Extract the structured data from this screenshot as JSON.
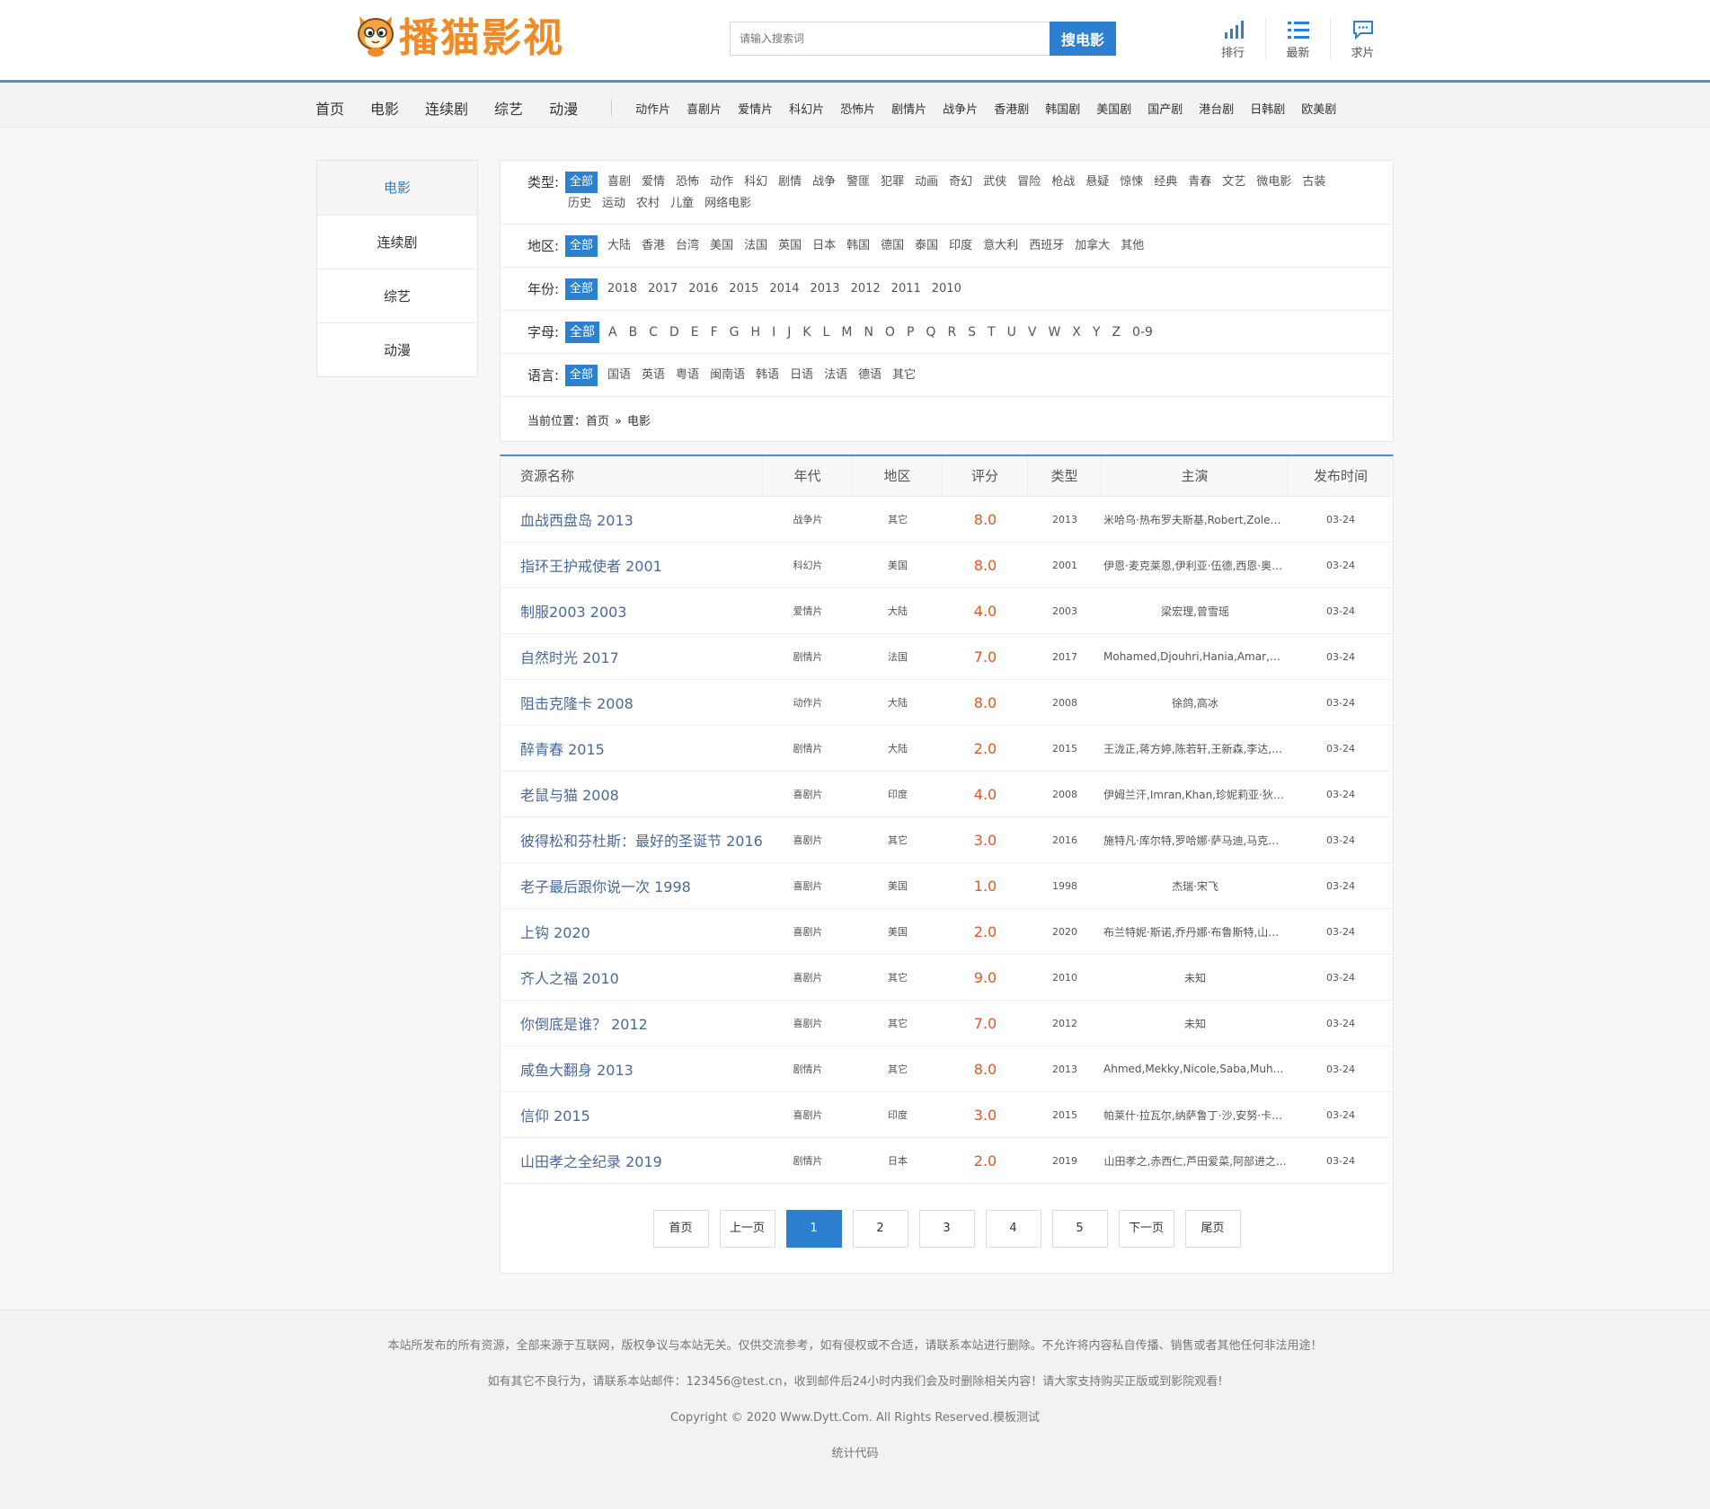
{
  "brand": {
    "logo_text": "播猫影视",
    "accent": "#2d7fd0",
    "logo_color": "#f08a24"
  },
  "search": {
    "placeholder": "请输入搜索词",
    "button": "搜电影"
  },
  "header_nav": [
    {
      "label": "排行",
      "icon": "bar-chart-icon"
    },
    {
      "label": "最新",
      "icon": "list-icon"
    },
    {
      "label": "求片",
      "icon": "chat-icon"
    }
  ],
  "main_nav": [
    "首页",
    "电影",
    "连续剧",
    "综艺",
    "动漫"
  ],
  "sub_nav": [
    "动作片",
    "喜剧片",
    "爱情片",
    "科幻片",
    "恐怖片",
    "剧情片",
    "战争片",
    "香港剧",
    "韩国剧",
    "美国剧",
    "国产剧",
    "港台剧",
    "日韩剧",
    "欧美剧"
  ],
  "side_nav": [
    "电影",
    "连续剧",
    "综艺",
    "动漫"
  ],
  "filters": {
    "type": {
      "label": "类型:",
      "options": [
        "全部",
        "喜剧",
        "爱情",
        "恐怖",
        "动作",
        "科幻",
        "剧情",
        "战争",
        "警匪",
        "犯罪",
        "动画",
        "奇幻",
        "武侠",
        "冒险",
        "枪战",
        "悬疑",
        "惊悚",
        "经典",
        "青春",
        "文艺",
        "微电影",
        "古装",
        "历史",
        "运动",
        "农村",
        "儿童",
        "网络电影"
      ]
    },
    "region": {
      "label": "地区:",
      "options": [
        "全部",
        "大陆",
        "香港",
        "台湾",
        "美国",
        "法国",
        "英国",
        "日本",
        "韩国",
        "德国",
        "泰国",
        "印度",
        "意大利",
        "西班牙",
        "加拿大",
        "其他"
      ]
    },
    "year": {
      "label": "年份:",
      "options": [
        "全部",
        "2018",
        "2017",
        "2016",
        "2015",
        "2014",
        "2013",
        "2012",
        "2011",
        "2010"
      ]
    },
    "letter": {
      "label": "字母:",
      "options": [
        "全部",
        "A",
        "B",
        "C",
        "D",
        "E",
        "F",
        "G",
        "H",
        "I",
        "J",
        "K",
        "L",
        "M",
        "N",
        "O",
        "P",
        "Q",
        "R",
        "S",
        "T",
        "U",
        "V",
        "W",
        "X",
        "Y",
        "Z",
        "0-9"
      ]
    },
    "language": {
      "label": "语言:",
      "options": [
        "全部",
        "国语",
        "英语",
        "粤语",
        "闽南语",
        "韩语",
        "日语",
        "法语",
        "德语",
        "其它"
      ]
    }
  },
  "breadcrumb": {
    "prefix": "当前位置：",
    "home": "首页",
    "sep": "»",
    "current": "电影"
  },
  "table": {
    "headers": [
      "资源名称",
      "年代",
      "地区",
      "评分",
      "类型",
      "主演",
      "发布时间"
    ],
    "rows": [
      [
        "血战西盘岛 2013",
        "战争片",
        "其它",
        "8.0",
        "2013",
        "米哈乌·热布罗夫斯基,Robert,Zoledzi...",
        "03-24"
      ],
      [
        "指环王护戒使者 2001",
        "科幻片",
        "美国",
        "8.0",
        "2001",
        "伊恩·麦克莱恩,伊利亚·伍德,西恩·奥斯...",
        "03-24"
      ],
      [
        "制服2003 2003",
        "爱情片",
        "大陆",
        "4.0",
        "2003",
        "梁宏理,曾雪瑶",
        "03-24"
      ],
      [
        "自然时光 2017",
        "剧情片",
        "法国",
        "7.0",
        "2017",
        "Mohamed,Djouhri,Hania,Amar,Has...",
        "03-24"
      ],
      [
        "阻击克隆卡 2008",
        "动作片",
        "大陆",
        "8.0",
        "2008",
        "徐鸽,高冰",
        "03-24"
      ],
      [
        "醉青春 2015",
        "剧情片",
        "大陆",
        "2.0",
        "2015",
        "王泷正,蒋方婷,陈若轩,王新森,李达,尚...",
        "03-24"
      ],
      [
        "老鼠与猫 2008",
        "喜剧片",
        "印度",
        "4.0",
        "2008",
        "伊姆兰汗,Imran,Khan,珍妮莉亚·狄索...",
        "03-24"
      ],
      [
        "彼得松和芬杜斯：最好的圣诞节 2016",
        "喜剧片",
        "其它",
        "3.0",
        "2016",
        "施特凡·库尔特,罗哈娜·萨马迪,马克斯·...",
        "03-24"
      ],
      [
        "老子最后跟你说一次 1998",
        "喜剧片",
        "美国",
        "1.0",
        "1998",
        "杰瑞·宋飞",
        "03-24"
      ],
      [
        "上钩 2020",
        "喜剧片",
        "美国",
        "2.0",
        "2020",
        "布兰特妮·斯诺,乔丹娜·布鲁斯特,山姆·...",
        "03-24"
      ],
      [
        "齐人之福 2010",
        "喜剧片",
        "其它",
        "9.0",
        "2010",
        "未知",
        "03-24"
      ],
      [
        "你倒底是谁？ 2012",
        "喜剧片",
        "其它",
        "7.0",
        "2012",
        "未知",
        "03-24"
      ],
      [
        "咸鱼大翻身 2013",
        "剧情片",
        "其它",
        "8.0",
        "2013",
        "Ahmed,Mekky,Nicole,Saba,Muha...",
        "03-24"
      ],
      [
        "信仰 2015",
        "喜剧片",
        "印度",
        "3.0",
        "2015",
        "帕莱什·拉瓦尔,纳萨鲁丁·沙,安努·卡波...",
        "03-24"
      ],
      [
        "山田孝之全纪录 2019",
        "剧情片",
        "日本",
        "2.0",
        "2019",
        "山田孝之,赤西仁,芦田爱菜,阿部进之...",
        "03-24"
      ]
    ]
  },
  "pager": {
    "first": "首页",
    "prev": "上一页",
    "pages": [
      "1",
      "2",
      "3",
      "4",
      "5"
    ],
    "current": "1",
    "next": "下一页",
    "last": "尾页"
  },
  "footer": {
    "line1": "本站所发布的所有资源，全部来源于互联网，版权争议与本站无关。仅供交流参考，如有侵权或不合适，请联系本站进行删除。不允许将内容私自传播、销售或者其他任何非法用途！",
    "line2": "如有其它不良行为，请联系本站邮件：123456@test.cn，收到邮件后24小时内我们会及时删除相关内容！请大家支持购买正版或到影院观看!",
    "line3": "Copyright © 2020 Www.Dytt.Com. All Rights Reserved.模板测试",
    "line4": "统计代码"
  }
}
